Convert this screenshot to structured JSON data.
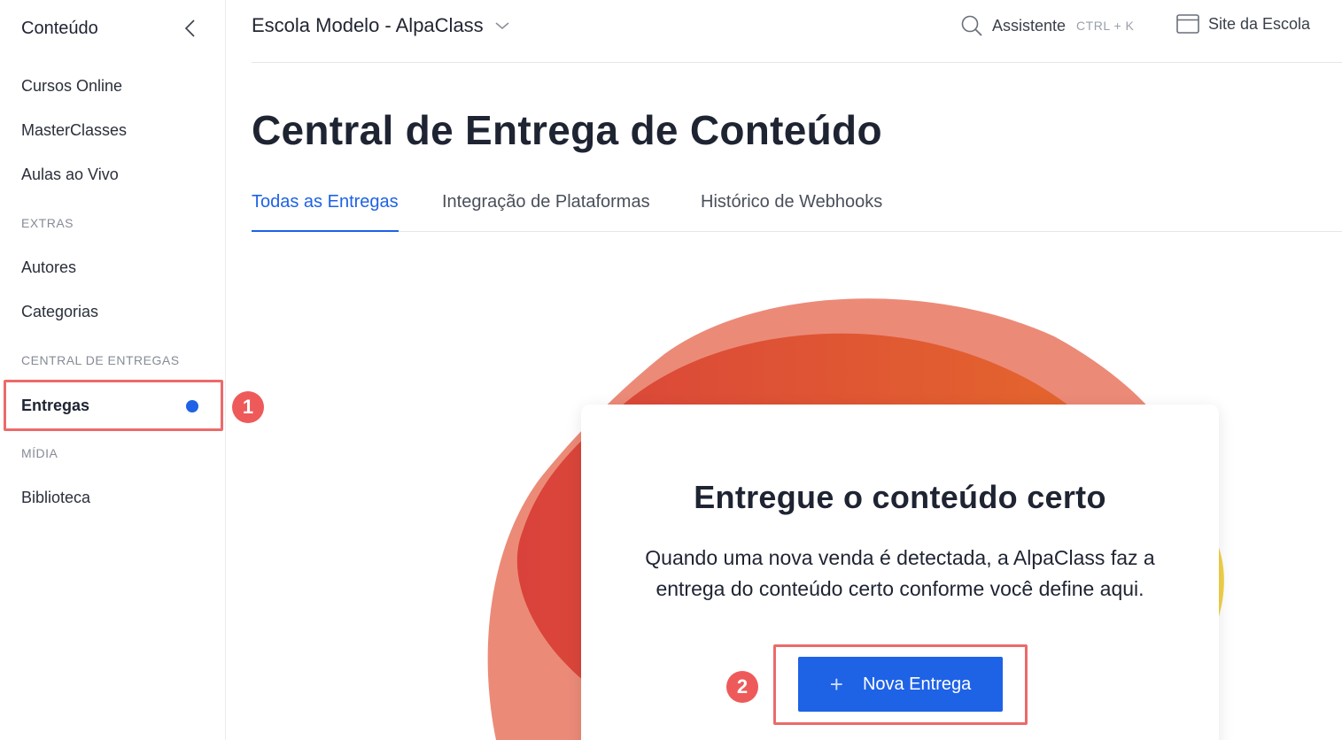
{
  "sidebar": {
    "title": "Conteúdo",
    "items": [
      "Cursos Online",
      "MasterClasses",
      "Aulas ao Vivo"
    ],
    "extras_title": "EXTRAS",
    "extras_items": [
      "Autores",
      "Categorias"
    ],
    "central_title": "CENTRAL DE ENTREGAS",
    "central_active": "Entregas",
    "media_title": "MÍDIA",
    "media_items": [
      "Biblioteca"
    ]
  },
  "badges": [
    "1",
    "2"
  ],
  "topbar": {
    "school": "Escola Modelo - AlpaClass",
    "assistant": "Assistente",
    "shortcut": "CTRL + K",
    "site": "Site da Escola"
  },
  "main": {
    "title": "Central de Entrega de Conteúdo",
    "tabs": [
      "Todas as Entregas",
      "Integração de Plataformas",
      "Histórico de Webhooks"
    ]
  },
  "card": {
    "title": "Entregue o conteúdo certo",
    "description": "Quando uma nova venda é detectada, a AlpaClass faz a entrega do conteúdo certo conforme você define aqui.",
    "button_label": "Nova Entrega",
    "button_icon": "+"
  },
  "colors": {
    "accent": "#1e62e6",
    "highlight": "#ec6a6a",
    "badge": "#ee5a5a"
  },
  "icons": [
    "chevron-left-icon",
    "chevron-down-icon",
    "search-icon",
    "browser-window-icon",
    "plus-icon"
  ]
}
